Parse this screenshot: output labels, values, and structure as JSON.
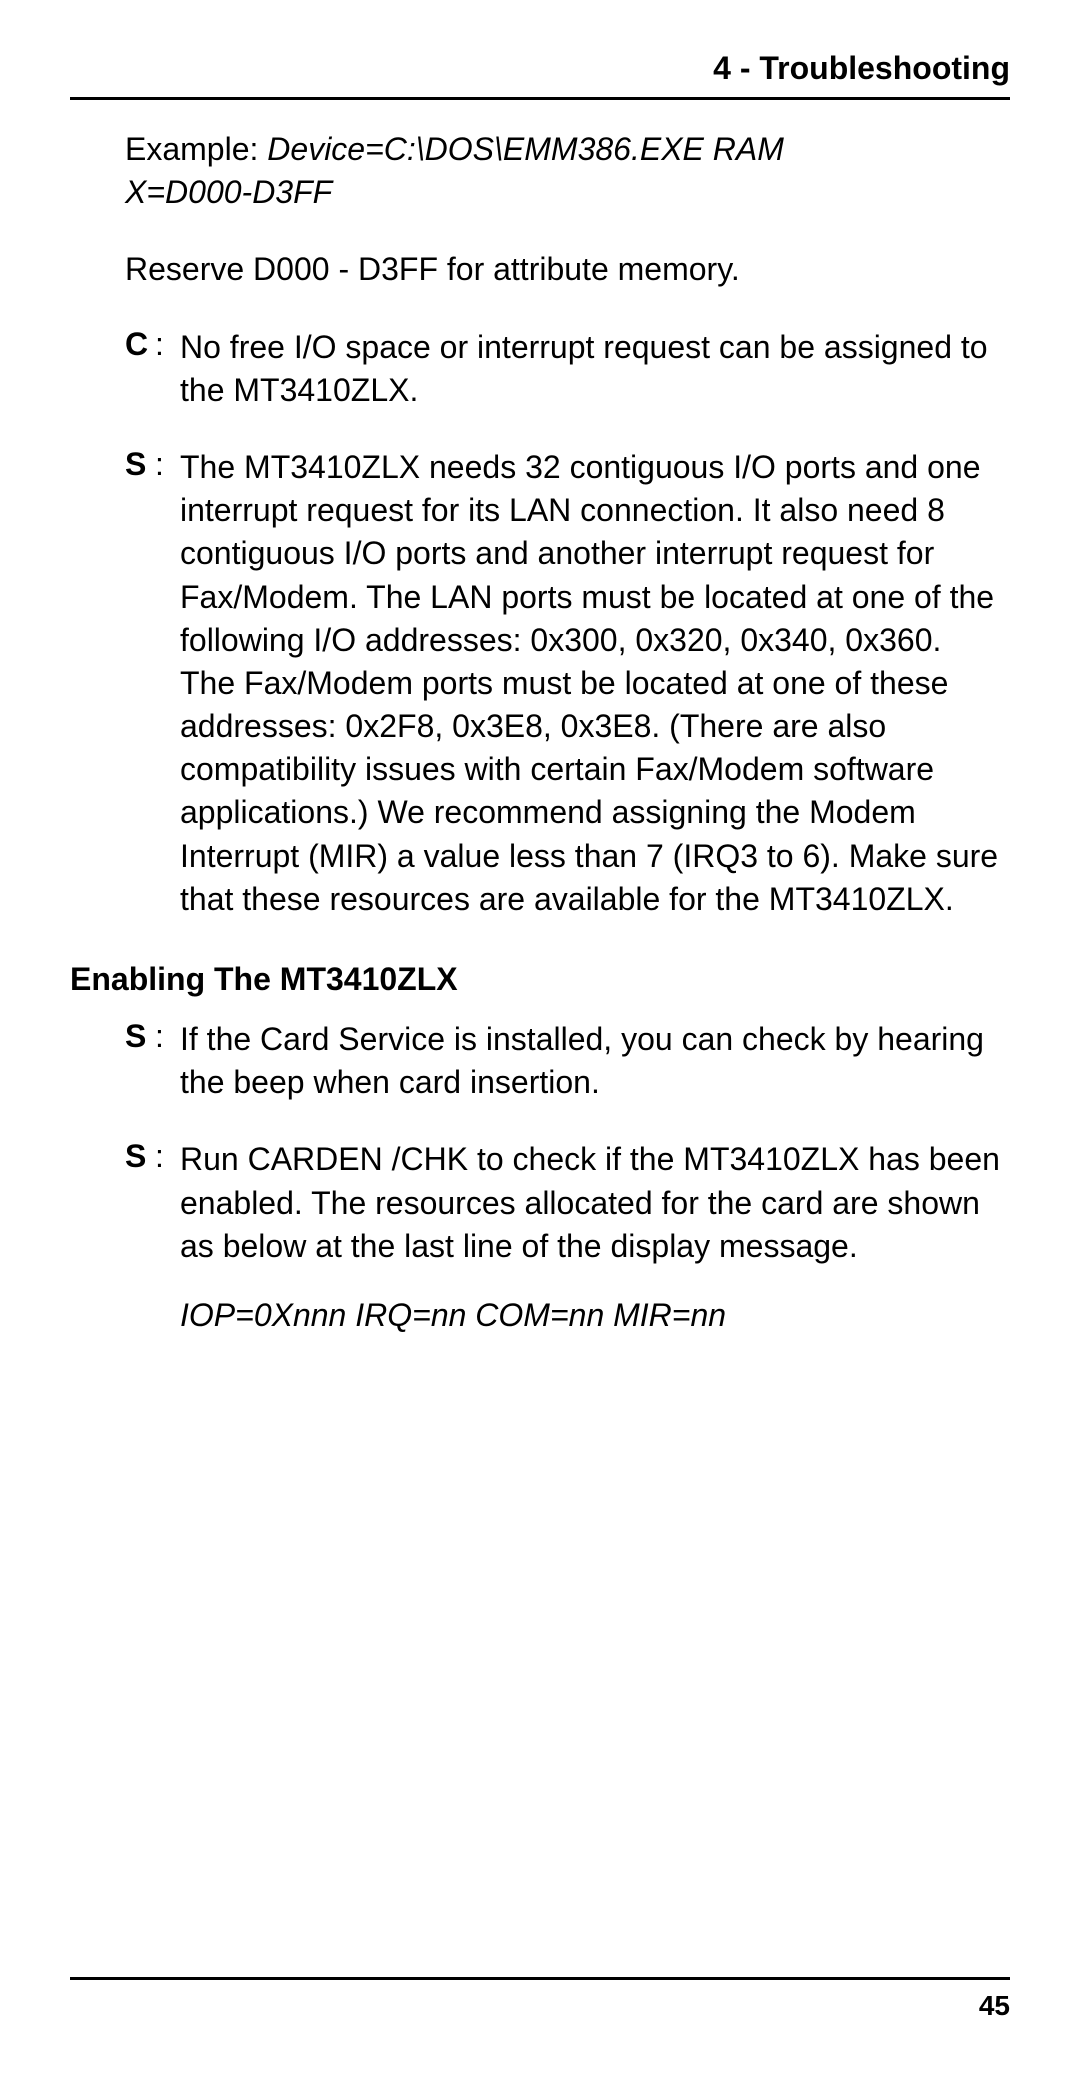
{
  "header": "4 - Troubleshooting",
  "example": {
    "lead": "Example: ",
    "line1": "Device=C:\\DOS\\EMM386.EXE RAM",
    "line2": "X=D000-D3FF"
  },
  "reserve": "Reserve D000 - D3FF for attribute memory.",
  "items": [
    {
      "label": "C",
      "body": "No free I/O space or interrupt request can be assigned to the MT3410ZLX."
    },
    {
      "label": "S",
      "body": "The MT3410ZLX needs 32 contiguous I/O ports and one interrupt request for its LAN connection. It also need 8 contiguous I/O ports and another interrupt request for Fax/Modem. The LAN ports must be located at one of the following I/O addresses: 0x300, 0x320, 0x340, 0x360. The Fax/Modem ports must be located at one of these addresses: 0x2F8, 0x3E8, 0x3E8. (There are also compatibility issues with certain Fax/Modem software applications.) We recommend assigning the Modem Interrupt (MIR) a value less than 7 (IRQ3 to 6).  Make sure that these resources are available for the MT3410ZLX."
    }
  ],
  "subhead": "Enabling The MT3410ZLX",
  "items2": [
    {
      "label": "S",
      "body": "If the Card Service is installed, you can check by  hearing the beep when card insertion."
    },
    {
      "label": "S",
      "body": "Run CARDEN /CHK  to check if  the MT3410ZLX has been enabled. The resources allocated for the card are shown as below at the last line of the display message."
    }
  ],
  "resline": "IOP=0Xnnn   IRQ=nn   COM=nn   MIR=nn",
  "pagenum": "45"
}
